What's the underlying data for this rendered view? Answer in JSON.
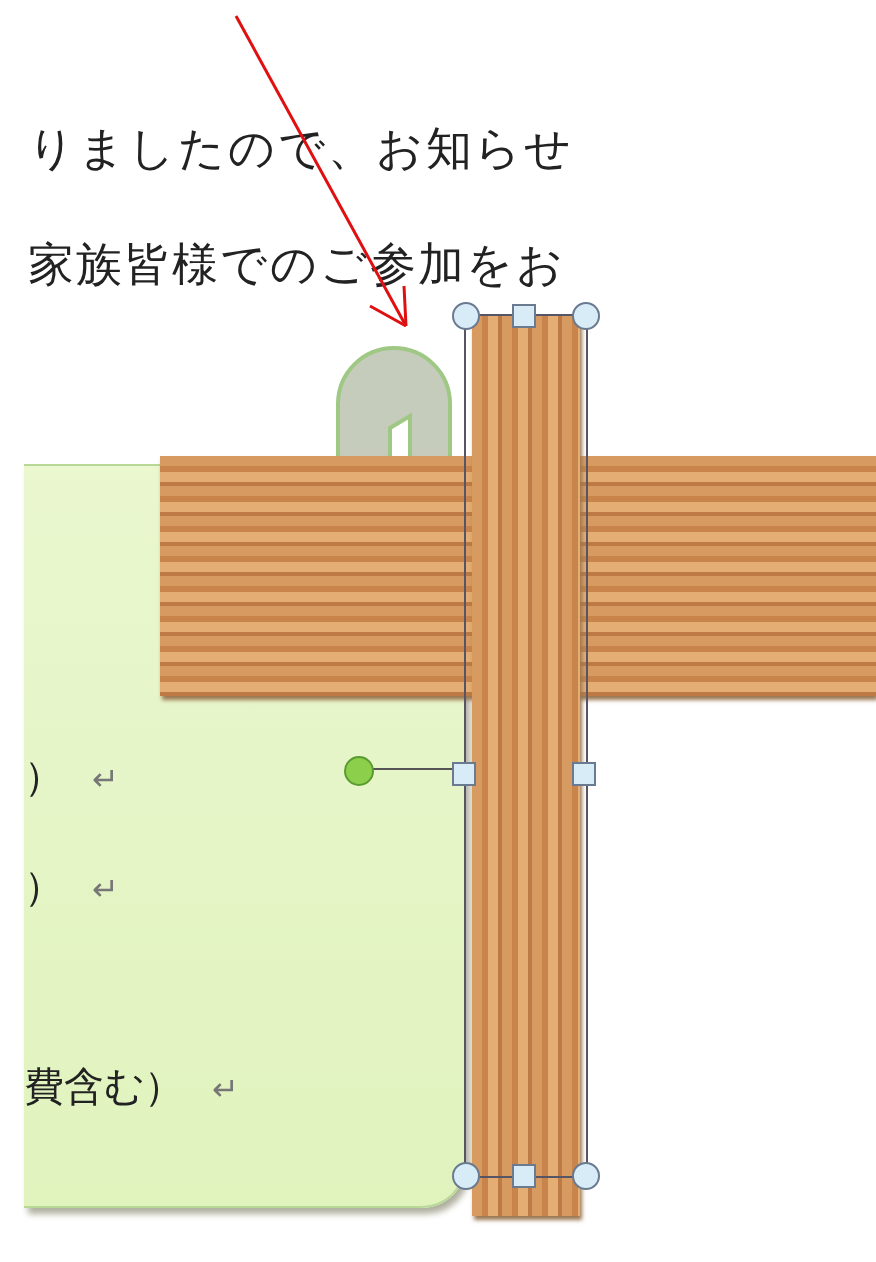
{
  "document": {
    "lines": [
      "りましたので、お知らせ",
      "家族皆様でのご参加をお"
    ]
  },
  "card": {
    "lines": [
      {
        "text": "）",
        "mark": "↵"
      },
      {
        "text": "）",
        "mark": "↵"
      },
      {
        "text": "費含む）",
        "mark": "↵"
      }
    ]
  }
}
